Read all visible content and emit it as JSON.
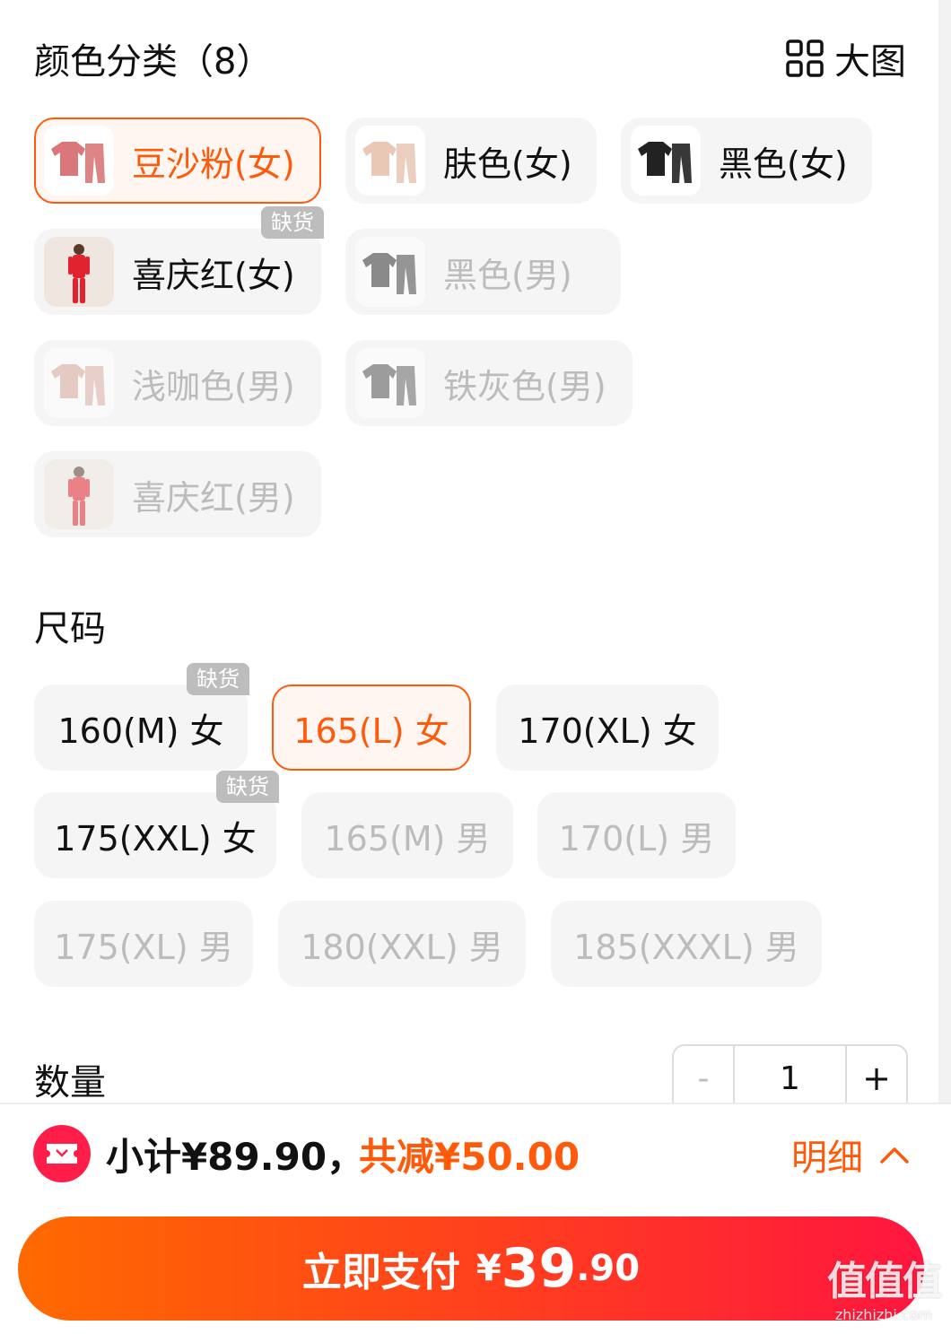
{
  "colors_section": {
    "title": "颜色分类（8）",
    "big_image_label": "大图",
    "out_of_stock_tag": "缺货",
    "options": [
      {
        "label": "豆沙粉(女)",
        "state": "selected",
        "thumb_color": "#d9777a"
      },
      {
        "label": "肤色(女)",
        "state": "available",
        "thumb_color": "#e9c9b6"
      },
      {
        "label": "黑色(女)",
        "state": "available",
        "thumb_color": "#222222"
      },
      {
        "label": "喜庆红(女)",
        "state": "available",
        "thumb_color": "#e0232e"
      },
      {
        "label": "黑色(男)",
        "state": "disabled",
        "thumb_color": "#333333"
      },
      {
        "label": "浅咖色(男)",
        "state": "disabled",
        "thumb_color": "#d9a79a"
      },
      {
        "label": "铁灰色(男)",
        "state": "disabled",
        "thumb_color": "#555555"
      },
      {
        "label": "喜庆红(男)",
        "state": "disabled",
        "thumb_color": "#e0232e"
      }
    ]
  },
  "size_section": {
    "title": "尺码",
    "out_of_stock_tag": "缺货",
    "options": [
      {
        "label": "160(M) 女",
        "state": "available"
      },
      {
        "label": "165(L) 女",
        "state": "selected"
      },
      {
        "label": "170(XL) 女",
        "state": "available"
      },
      {
        "label": "175(XXL) 女",
        "state": "available"
      },
      {
        "label": "165(M) 男",
        "state": "disabled"
      },
      {
        "label": "170(L) 男",
        "state": "disabled"
      },
      {
        "label": "175(XL) 男",
        "state": "disabled"
      },
      {
        "label": "180(XXL) 男",
        "state": "disabled"
      },
      {
        "label": "185(XXXL) 男",
        "state": "disabled"
      }
    ]
  },
  "quantity_section": {
    "title": "数量",
    "minus": "-",
    "value": "1",
    "plus": "+"
  },
  "summary": {
    "subtotal": "小计¥89.90，",
    "discount": "共减¥50.00",
    "details_label": "明细"
  },
  "pay_button": {
    "label": "立即支付",
    "currency": "¥",
    "amount_int": "39",
    "amount_dec": ".90"
  },
  "watermark": {
    "main": "值值值",
    "sub": "zhizhizhi.com"
  },
  "colors": {
    "accent": "#ff5a0a",
    "disabled_text": "#bcbcbc",
    "tag_bg": "#bdbdbd",
    "pay_gradient_start": "#ff6a00",
    "pay_gradient_end": "#ff1640"
  }
}
